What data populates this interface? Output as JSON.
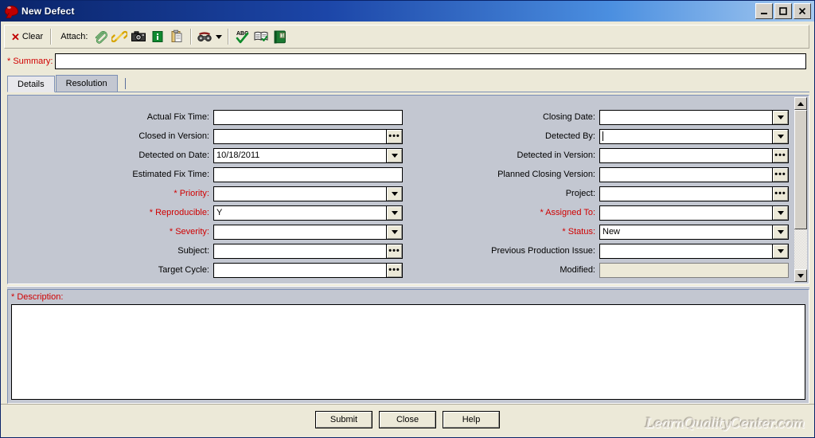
{
  "window": {
    "title": "New Defect",
    "icon": "speech-bubble-icon",
    "buttons": {
      "minimize": "_",
      "maximize": "□",
      "close": "✕"
    }
  },
  "toolbar": {
    "clear_label": "Clear",
    "attach_label": "Attach:",
    "icons": [
      {
        "name": "paperclip-icon",
        "tip": "Attach File"
      },
      {
        "name": "link-icon",
        "tip": "Attach URL"
      },
      {
        "name": "camera-icon",
        "tip": "Attach Snapshot"
      },
      {
        "name": "system-info-icon",
        "tip": "Attach System Info"
      },
      {
        "name": "clipboard-icon",
        "tip": "Attach Clipboard"
      },
      {
        "name": "binoculars-icon",
        "tip": "Find"
      },
      {
        "name": "spell-check-icon",
        "tip": "Check Spelling"
      },
      {
        "name": "thesaurus-icon",
        "tip": "Thesaurus"
      },
      {
        "name": "dictionary-icon",
        "tip": "Spelling Options"
      }
    ]
  },
  "summary": {
    "label": "* Summary:",
    "value": "",
    "placeholder": ""
  },
  "tabs": [
    {
      "id": "details",
      "label": "Details",
      "active": true
    },
    {
      "id": "resolution",
      "label": "Resolution",
      "active": false
    }
  ],
  "details": {
    "left_fields": [
      {
        "label": "Actual Fix Time:",
        "value": "",
        "required": false,
        "control": "text"
      },
      {
        "label": "Closed in Version:",
        "value": "",
        "required": false,
        "control": "browse"
      },
      {
        "label": "Detected on Date:",
        "value": "10/18/2011",
        "required": false,
        "control": "dropdown"
      },
      {
        "label": "Estimated Fix Time:",
        "value": "",
        "required": false,
        "control": "text"
      },
      {
        "label": "* Priority:",
        "value": "",
        "required": true,
        "control": "dropdown"
      },
      {
        "label": "* Reproducible:",
        "value": "Y",
        "required": true,
        "control": "dropdown"
      },
      {
        "label": "* Severity:",
        "value": "",
        "required": true,
        "control": "dropdown"
      },
      {
        "label": "Subject:",
        "value": "",
        "required": false,
        "control": "browse"
      },
      {
        "label": "Target Cycle:",
        "value": "",
        "required": false,
        "control": "browse"
      }
    ],
    "right_fields": [
      {
        "label": "Closing Date:",
        "value": "",
        "required": false,
        "control": "dropdown"
      },
      {
        "label": "Detected By:",
        "value": "",
        "required": false,
        "control": "dropdown",
        "focused": true
      },
      {
        "label": "Detected in Version:",
        "value": "",
        "required": false,
        "control": "browse"
      },
      {
        "label": "Planned Closing Version:",
        "value": "",
        "required": false,
        "control": "browse"
      },
      {
        "label": "Project:",
        "value": "",
        "required": false,
        "control": "browse"
      },
      {
        "label": "* Assigned To:",
        "value": "",
        "required": true,
        "control": "dropdown"
      },
      {
        "label": "* Status:",
        "value": "New",
        "required": true,
        "control": "dropdown"
      },
      {
        "label": "Previous Production Issue:",
        "value": "",
        "required": false,
        "control": "dropdown"
      },
      {
        "label": "Modified:",
        "value": "",
        "required": false,
        "control": "readonly"
      }
    ],
    "scrollbar": {
      "position_percent": 0,
      "thumb_percent": 75
    }
  },
  "description": {
    "label": "* Description:",
    "value": ""
  },
  "footer": {
    "submit_label": "Submit",
    "close_label": "Close",
    "help_label": "Help",
    "watermark": "LearnQualityCenter.com"
  },
  "colors": {
    "title_start": "#0a246a",
    "title_end": "#a6caf0",
    "required": "#d00000",
    "panel": "#c3c7d1",
    "chrome": "#ece9d8"
  }
}
